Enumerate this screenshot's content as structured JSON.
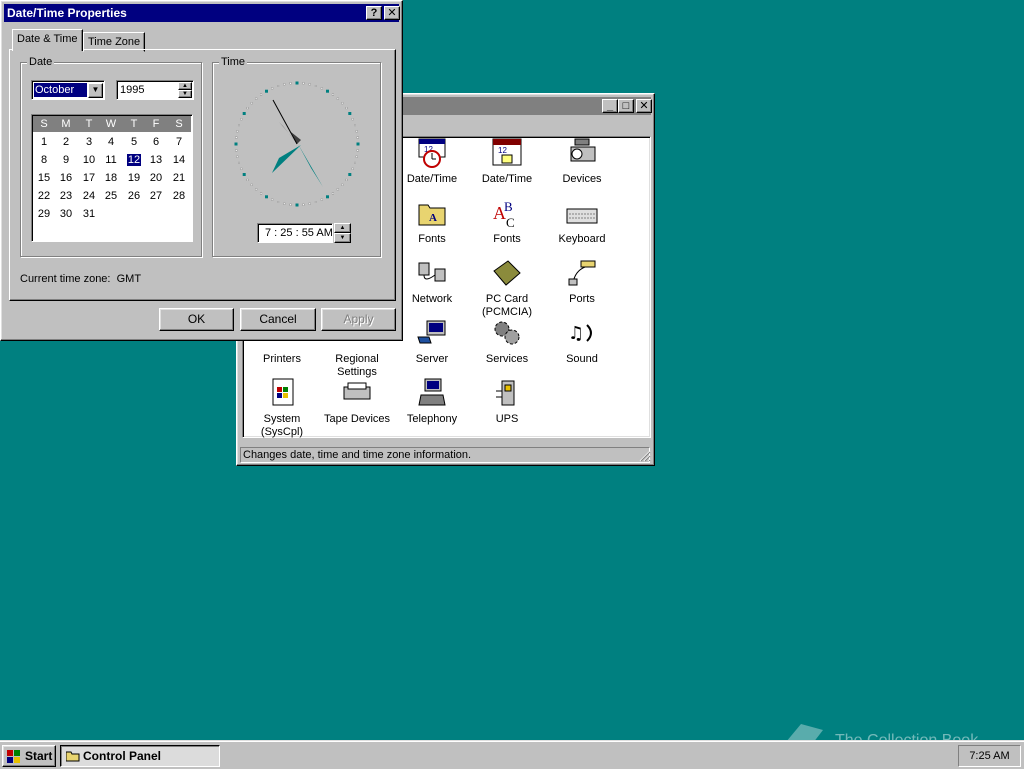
{
  "control_panel": {
    "status_text": "Changes date, time and time zone information.",
    "items": [
      {
        "label": "Date/Time",
        "icon": "datetime-icon"
      },
      {
        "label": "Date/Time",
        "icon": "datetime-calendar-icon"
      },
      {
        "label": "Devices",
        "icon": "devices-icon"
      },
      {
        "label": "Fonts",
        "icon": "fonts-folder-icon"
      },
      {
        "label": "Fonts",
        "icon": "fonts-abc-icon"
      },
      {
        "label": "Keyboard",
        "icon": "keyboard-icon"
      },
      {
        "label": "Network",
        "icon": "network-icon"
      },
      {
        "label": "PC Card (PCMCIA)",
        "icon": "pc-card-icon"
      },
      {
        "label": "Ports",
        "icon": "ports-icon"
      },
      {
        "label": "Printers",
        "icon": "printers-icon"
      },
      {
        "label": "Regional Settings",
        "icon": "globe-icon"
      },
      {
        "label": "Server",
        "icon": "server-icon"
      },
      {
        "label": "Services",
        "icon": "services-icon"
      },
      {
        "label": "Sound",
        "icon": "sound-icon"
      },
      {
        "label": "System (SysCpl)",
        "icon": "system-icon"
      },
      {
        "label": "Tape Devices",
        "icon": "tape-icon"
      },
      {
        "label": "Telephony",
        "icon": "telephony-icon"
      },
      {
        "label": "UPS",
        "icon": "ups-icon"
      }
    ]
  },
  "dialog": {
    "title": "Date/Time Properties",
    "help_button": "?",
    "close_button": "✕",
    "tabs": [
      "Date & Time",
      "Time Zone"
    ],
    "date_group": "Date",
    "time_group": "Time",
    "month": "October",
    "year": "1995",
    "weekdays": [
      "S",
      "M",
      "T",
      "W",
      "T",
      "F",
      "S"
    ],
    "selected_day": "12",
    "days": [
      "1",
      "2",
      "3",
      "4",
      "5",
      "6",
      "7",
      "8",
      "9",
      "10",
      "11",
      "12",
      "13",
      "14",
      "15",
      "16",
      "17",
      "18",
      "19",
      "20",
      "21",
      "22",
      "23",
      "24",
      "25",
      "26",
      "27",
      "28",
      "29",
      "30",
      "31"
    ],
    "time_value": "7 : 25 : 55 AM",
    "timezone_label": "Current time zone:",
    "timezone_value": "GMT",
    "ok": "OK",
    "cancel": "Cancel",
    "apply": "Apply"
  },
  "taskbar": {
    "start": "Start",
    "task": "Control Panel",
    "clock": "7:25 AM"
  },
  "watermark": "The Collection Book",
  "colors": {
    "desktop": "#008080",
    "title_active": "#000080",
    "title_inactive": "#808080",
    "face": "#c0c0c0"
  }
}
